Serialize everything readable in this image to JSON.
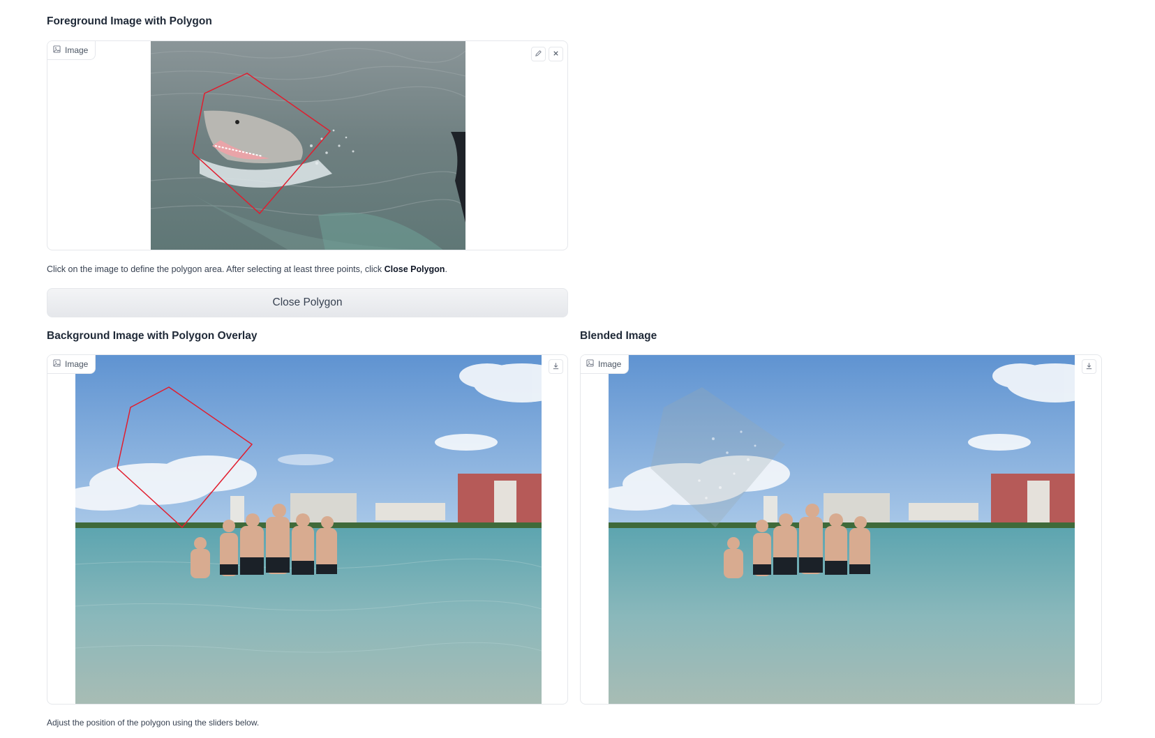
{
  "foreground": {
    "title": "Foreground Image with Polygon",
    "label": "Image",
    "icons": [
      "image-icon",
      "edit-icon",
      "close-icon"
    ]
  },
  "instructions": {
    "prefix": "Click on the image to define the polygon area. After selecting at least three points, click ",
    "emphasis": "Close Polygon",
    "suffix": "."
  },
  "close_button": {
    "label": "Close Polygon"
  },
  "background": {
    "title": "Background Image with Polygon Overlay",
    "label": "Image",
    "icons": [
      "image-icon",
      "download-icon"
    ]
  },
  "blended": {
    "title": "Blended Image",
    "label": "Image",
    "icons": [
      "image-icon",
      "download-icon"
    ]
  },
  "footer_note": "Adjust the position of the polygon using the sliders below.",
  "colors": {
    "polygon": "#e11d2e",
    "water": "#6f8f8c",
    "sky": "#7aa6da",
    "sea": "#7bb3b6"
  }
}
